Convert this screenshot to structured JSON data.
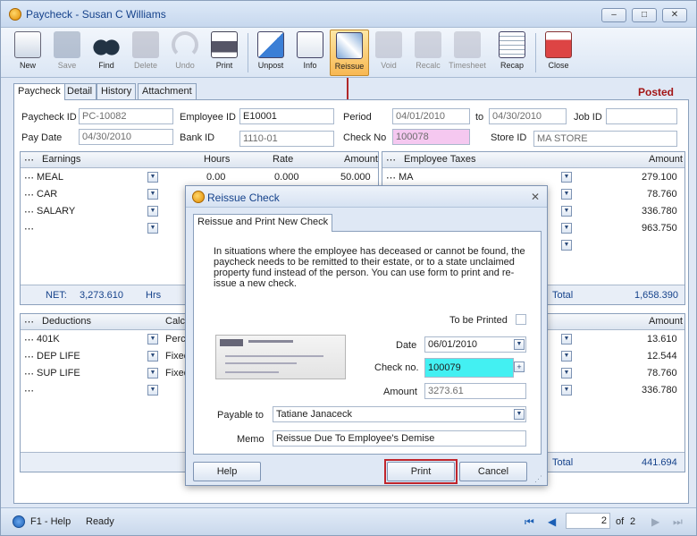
{
  "window": {
    "title": "Paycheck - Susan C Williams",
    "controls": [
      "–",
      "□",
      "✕"
    ]
  },
  "toolbar": {
    "buttons": [
      {
        "label": "New",
        "icon": "new-document-icon",
        "disabled": false
      },
      {
        "label": "Save",
        "icon": "floppy-disk-icon",
        "disabled": true
      },
      {
        "label": "Find",
        "icon": "binoculars-icon",
        "disabled": false
      },
      {
        "label": "Delete",
        "icon": "trash-icon",
        "disabled": true
      },
      {
        "label": "Undo",
        "icon": "undo-arrow-icon",
        "disabled": true
      },
      {
        "label": "Print",
        "icon": "printer-icon",
        "disabled": false
      },
      {
        "label": "Unpost",
        "icon": "unpost-icon",
        "disabled": false
      },
      {
        "label": "Info",
        "icon": "info-icon",
        "disabled": false
      },
      {
        "label": "Reissue",
        "icon": "reissue-icon",
        "disabled": false,
        "active": true
      },
      {
        "label": "Void",
        "icon": "void-icon",
        "disabled": true
      },
      {
        "label": "Recalc",
        "icon": "calculator-icon",
        "disabled": true
      },
      {
        "label": "Timesheet",
        "icon": "timesheet-icon",
        "disabled": true
      },
      {
        "label": "Recap",
        "icon": "recap-icon",
        "disabled": false
      },
      {
        "label": "Close",
        "icon": "close-window-icon",
        "disabled": false
      }
    ]
  },
  "tabs": [
    "Paycheck",
    "Detail",
    "History",
    "Attachment"
  ],
  "status_posted": "Posted",
  "header": {
    "paycheck_id_label": "Paycheck ID",
    "paycheck_id": "PC-10082",
    "employee_id_label": "Employee ID",
    "employee_id": "E10001",
    "period_label": "Period",
    "period_from": "04/01/2010",
    "period_to_label": "to",
    "period_to": "04/30/2010",
    "job_id_label": "Job ID",
    "job_id": "",
    "pay_date_label": "Pay Date",
    "pay_date": "04/30/2010",
    "bank_id_label": "Bank ID",
    "bank_id": "1110-01",
    "check_no_label": "Check No",
    "check_no": "100078",
    "store_id_label": "Store ID",
    "store_id": "MA STORE"
  },
  "earnings": {
    "columns": [
      "Earnings",
      "Hours",
      "Rate",
      "Amount"
    ],
    "rows": [
      {
        "name": "MEAL",
        "hours": "0.00",
        "rate": "0.000",
        "amount": "50.000"
      },
      {
        "name": "CAR",
        "hours": "",
        "rate": "",
        "amount": ""
      },
      {
        "name": "SALARY",
        "hours": "",
        "rate": "",
        "amount": ""
      },
      {
        "name": "",
        "hours": "",
        "rate": "",
        "amount": ""
      }
    ],
    "net_label": "NET:",
    "net_value": "3,273.610",
    "hrs_label": "Hrs"
  },
  "taxes": {
    "columns": [
      "Employee Taxes",
      "Amount"
    ],
    "rows": [
      {
        "name": "MA",
        "amount": "279.100"
      },
      {
        "name": "",
        "amount": "78.760"
      },
      {
        "name": "",
        "amount": "336.780"
      },
      {
        "name": "",
        "amount": "963.750"
      },
      {
        "name": "",
        "amount": ""
      }
    ],
    "total_label": "Total",
    "total_value": "1,658.390"
  },
  "deductions": {
    "columns": [
      "Deductions",
      "Calcu"
    ],
    "rows": [
      {
        "name": "401K",
        "calc": "Perce"
      },
      {
        "name": "DEP LIFE",
        "calc": "Fixed"
      },
      {
        "name": "SUP LIFE",
        "calc": "Fixed"
      },
      {
        "name": "",
        "calc": ""
      }
    ]
  },
  "benefits": {
    "columns": [
      "Amount"
    ],
    "rows": [
      "13.610",
      "12.544",
      "78.760",
      "336.780"
    ],
    "total_label": "Total",
    "total_value": "441.694"
  },
  "dialog": {
    "title": "Reissue Check",
    "tab": "Reissue and Print New Check",
    "description": "In situations where the employee has deceased or cannot be found, the paycheck needs to be remitted to their estate, or to a state unclaimed property fund instead of the person. You can use form to print and re-issue a new check.",
    "to_be_printed_label": "To be Printed",
    "date_label": "Date",
    "date": "06/01/2010",
    "check_no_label": "Check no.",
    "check_no": "100079",
    "amount_label": "Amount",
    "amount": "3273.61",
    "payable_label": "Payable to",
    "payable": "Tatiane Janaceck",
    "memo_label": "Memo",
    "memo": "Reissue Due To Employee's Demise",
    "help_label": "Help",
    "print_label": "Print",
    "cancel_label": "Cancel"
  },
  "statusbar": {
    "help": "F1 - Help",
    "status": "Ready",
    "page": "2",
    "of_label": "of",
    "total_pages": "2"
  }
}
